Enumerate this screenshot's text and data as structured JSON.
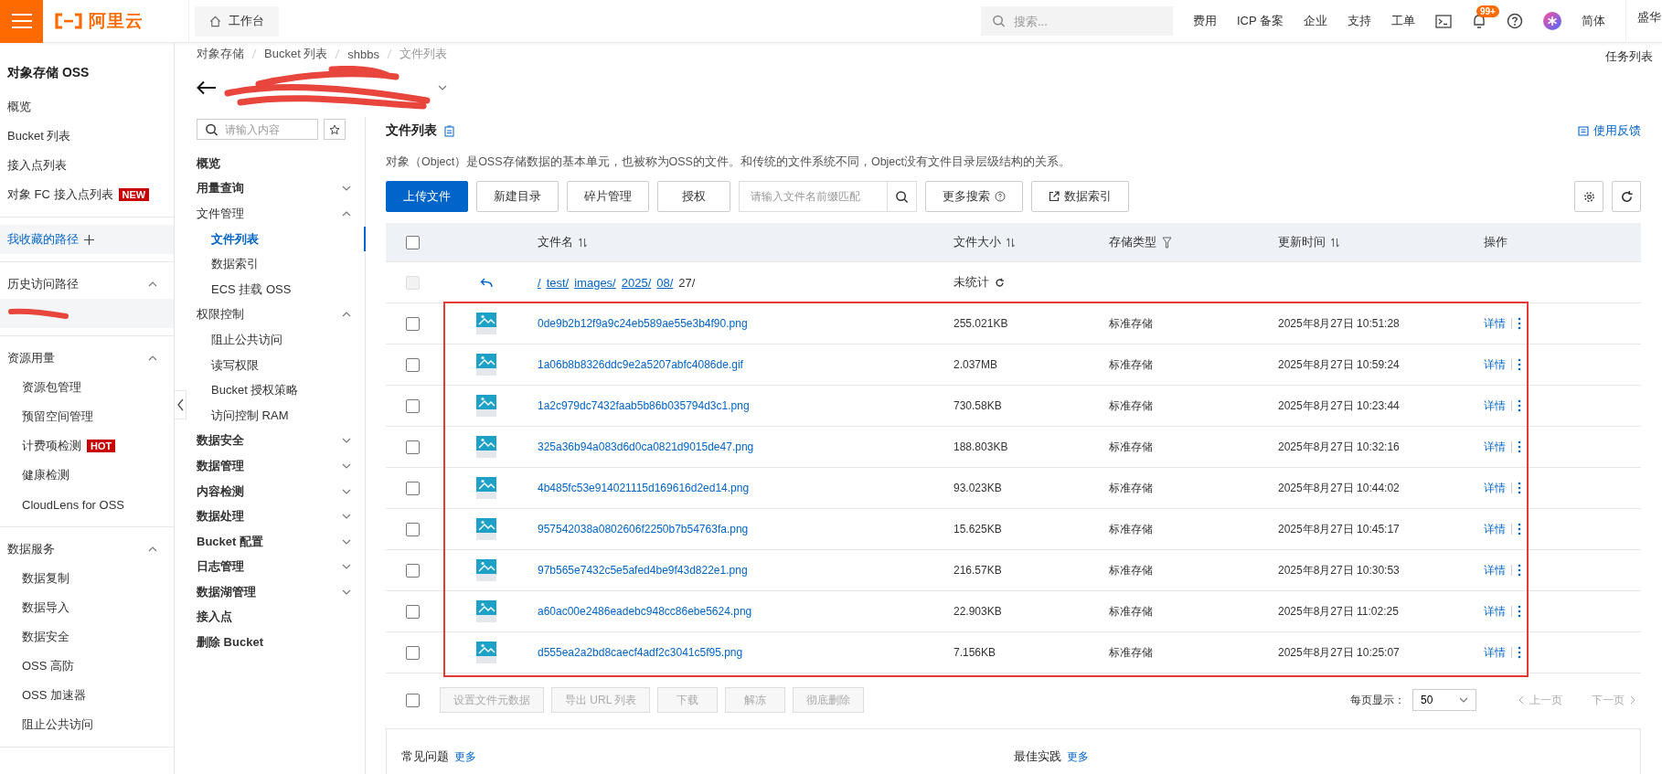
{
  "topbar": {
    "brand": "阿里云",
    "workbench": "工作台",
    "search_placeholder": "搜索...",
    "links": [
      "费用",
      "ICP 备案",
      "企业",
      "支持",
      "工单"
    ],
    "notification_badge": "99+",
    "language": "简体",
    "account": "盛华"
  },
  "sidebar": {
    "title": "对象存储 OSS",
    "items": [
      {
        "label": "概览"
      },
      {
        "label": "Bucket 列表"
      },
      {
        "label": "接入点列表"
      },
      {
        "label": "对象 FC 接入点列表",
        "badge": "NEW"
      }
    ],
    "favorites": "我收藏的路径",
    "history": {
      "label": "历史访问路径",
      "expanded": true
    },
    "groups": [
      {
        "label": "资源用量",
        "expanded": true,
        "children": [
          {
            "label": "资源包管理"
          },
          {
            "label": "预留空间管理"
          },
          {
            "label": "计费项检测",
            "badge": "HOT"
          },
          {
            "label": "健康检测"
          },
          {
            "label": "CloudLens for OSS"
          }
        ]
      },
      {
        "label": "数据服务",
        "expanded": true,
        "children": [
          {
            "label": "数据复制"
          },
          {
            "label": "数据导入"
          },
          {
            "label": "数据安全"
          },
          {
            "label": "OSS 高防"
          },
          {
            "label": "OSS 加速器"
          },
          {
            "label": "阻止公共访问"
          }
        ]
      }
    ]
  },
  "breadcrumb": [
    "对象存储",
    "Bucket 列表",
    "shbbs",
    "文件列表"
  ],
  "task_list": "任务列表",
  "bucket_nav": {
    "search_placeholder": "请输入内容",
    "items": [
      {
        "kind": "link",
        "label": "概览"
      },
      {
        "kind": "group",
        "label": "用量查询",
        "expanded": false
      },
      {
        "kind": "group",
        "label": "文件管理",
        "expanded": true,
        "children": [
          {
            "label": "文件列表",
            "selected": true
          },
          {
            "label": "数据索引",
            "selected": false
          },
          {
            "label": "ECS 挂载 OSS",
            "selected": false
          }
        ]
      },
      {
        "kind": "group",
        "label": "权限控制",
        "expanded": true,
        "children": [
          {
            "label": "阻止公共访问",
            "selected": false
          },
          {
            "label": "读写权限",
            "selected": false
          },
          {
            "label": "Bucket 授权策略",
            "selected": false
          },
          {
            "label": "访问控制 RAM",
            "selected": false
          }
        ]
      },
      {
        "kind": "group",
        "label": "数据安全",
        "expanded": false
      },
      {
        "kind": "group",
        "label": "数据管理",
        "expanded": false
      },
      {
        "kind": "group",
        "label": "内容检测",
        "expanded": false
      },
      {
        "kind": "group",
        "label": "数据处理",
        "expanded": false
      },
      {
        "kind": "group",
        "label": "Bucket 配置",
        "expanded": false
      },
      {
        "kind": "group",
        "label": "日志管理",
        "expanded": false
      },
      {
        "kind": "group",
        "label": "数据湖管理",
        "expanded": false
      },
      {
        "kind": "link",
        "label": "接入点"
      },
      {
        "kind": "link",
        "label": "删除 Bucket"
      }
    ]
  },
  "files": {
    "title": "文件列表",
    "feedback": "使用反馈",
    "description": "对象（Object）是OSS存储数据的基本单元，也被称为OSS的文件。和传统的文件系统不同，Object没有文件目录层级结构的关系。",
    "toolbar": [
      {
        "kind": "primary",
        "label": "上传文件"
      },
      {
        "kind": "default",
        "label": "新建目录"
      },
      {
        "kind": "default",
        "label": "碎片管理"
      },
      {
        "kind": "default",
        "label": "授权"
      }
    ],
    "filter_placeholder": "请输入文件名前缀匹配",
    "more_search": "更多搜索",
    "data_index": "数据索引",
    "all_checked": false,
    "columns": [
      {
        "label": "文件名",
        "kind": "sortable"
      },
      {
        "label": "文件大小",
        "kind": "sortable"
      },
      {
        "label": "存储类型",
        "kind": "filterable"
      },
      {
        "label": "更新时间",
        "kind": "sortable"
      },
      {
        "label": "操作",
        "kind": "plain"
      }
    ],
    "path": {
      "segments": [
        "/",
        "test/",
        "images/",
        "2025/",
        "08/"
      ],
      "current": "27/",
      "size": "未统计",
      "disabled": true
    },
    "rows": [
      {
        "name": "0de9b2b12f9a9c24eb589ae55e3b4f90.png",
        "size": "255.021KB",
        "type": "标准存储",
        "time": "2025年8月27日 10:51:28",
        "action": "详情",
        "checked": false
      },
      {
        "name": "1a06b8b8326ddc9e2a5207abfc4086de.gif",
        "size": "2.037MB",
        "type": "标准存储",
        "time": "2025年8月27日 10:59:24",
        "action": "详情",
        "checked": false
      },
      {
        "name": "1a2c979dc7432faab5b86b035794d3c1.png",
        "size": "730.58KB",
        "type": "标准存储",
        "time": "2025年8月27日 10:23:44",
        "action": "详情",
        "checked": false
      },
      {
        "name": "325a36b94a083d6d0ca0821d9015de47.png",
        "size": "188.803KB",
        "type": "标准存储",
        "time": "2025年8月27日 10:32:16",
        "action": "详情",
        "checked": false
      },
      {
        "name": "4b485fc53e914021115d169616d2ed14.png",
        "size": "93.023KB",
        "type": "标准存储",
        "time": "2025年8月27日 10:44:02",
        "action": "详情",
        "checked": false
      },
      {
        "name": "957542038a0802606f2250b7b54763fa.png",
        "size": "15.625KB",
        "type": "标准存储",
        "time": "2025年8月27日 10:45:17",
        "action": "详情",
        "checked": false
      },
      {
        "name": "97b565e7432c5e5afed4be9f43d822e1.png",
        "size": "216.57KB",
        "type": "标准存储",
        "time": "2025年8月27日 10:30:53",
        "action": "详情",
        "checked": false
      },
      {
        "name": "a60ac00e2486eadebc948cc86ebe5624.png",
        "size": "22.903KB",
        "type": "标准存储",
        "time": "2025年8月27日 11:02:25",
        "action": "详情",
        "checked": false
      },
      {
        "name": "d555ea2a2bd8caecf4adf2c3041c5f95.png",
        "size": "7.156KB",
        "type": "标准存储",
        "time": "2025年8月27日 10:25:07",
        "action": "详情",
        "checked": false
      }
    ],
    "footer_checked": false,
    "batch_actions": [
      {
        "label": "设置文件元数据",
        "disabled": true
      },
      {
        "label": "导出 URL 列表",
        "disabled": true
      },
      {
        "label": "下载",
        "disabled": true
      },
      {
        "label": "解冻",
        "disabled": true
      },
      {
        "label": "彻底删除",
        "disabled": true
      }
    ],
    "page_size_label": "每页显示：",
    "page_size": "50",
    "prev": {
      "label": "上一页",
      "disabled": true
    },
    "next": {
      "label": "下一页",
      "disabled": true
    }
  },
  "cards": [
    {
      "title": "常见问题",
      "more": "更多"
    },
    {
      "title": "最佳实践",
      "more": "更多"
    }
  ]
}
